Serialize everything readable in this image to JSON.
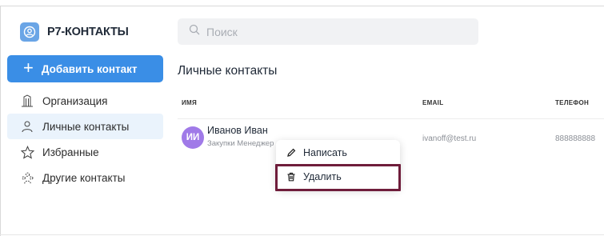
{
  "app": {
    "title": "Р7-КОНТАКТЫ"
  },
  "sidebar": {
    "add_button": "Добавить контакт",
    "items": [
      {
        "label": "Организация",
        "icon": "building-icon",
        "active": false
      },
      {
        "label": "Личные контакты",
        "icon": "person-icon",
        "active": true
      },
      {
        "label": "Избранные",
        "icon": "star-icon",
        "active": false
      },
      {
        "label": "Другие контакты",
        "icon": "group-icon",
        "active": false
      }
    ]
  },
  "search": {
    "placeholder": "Поиск",
    "value": ""
  },
  "main": {
    "title": "Личные контакты",
    "columns": {
      "name": "ИМЯ",
      "email": "EMAIL",
      "phone": "ТЕЛЕФОН"
    },
    "rows": [
      {
        "initials": "ИИ",
        "name": "Иванов Иван",
        "role": "Закупки Менеджер",
        "email": "ivanoff@test.ru",
        "phone": "888888888"
      }
    ]
  },
  "context_menu": {
    "write": "Написать",
    "delete": "Удалить"
  },
  "colors": {
    "accent": "#3a8ee6",
    "avatar": "#a07ae8",
    "highlight": "#6f1d3b",
    "active_nav": "#eaf3fc"
  }
}
